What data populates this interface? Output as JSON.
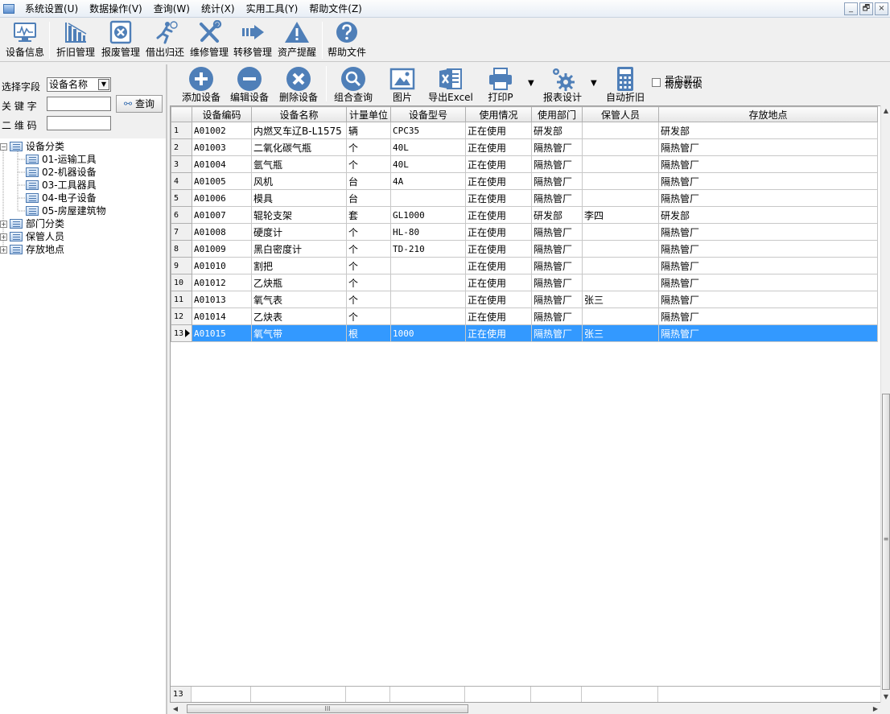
{
  "menu": {
    "items": [
      "系统设置(U)",
      "数据操作(V)",
      "查询(W)",
      "统计(X)",
      "实用工具(Y)",
      "帮助文件(Z)"
    ],
    "window_buttons": [
      "_",
      "🗗",
      "×"
    ]
  },
  "main_toolbar": {
    "buttons": [
      {
        "label": "设备信息",
        "icon": "monitor-icon"
      },
      {
        "label": "折旧管理",
        "icon": "depreciation-chart-icon"
      },
      {
        "label": "报废管理",
        "icon": "scrap-box-icon"
      },
      {
        "label": "借出归还",
        "icon": "lend-return-icon"
      },
      {
        "label": "维修管理",
        "icon": "repair-tools-icon"
      },
      {
        "label": "转移管理",
        "icon": "transfer-arrow-icon"
      },
      {
        "label": "资产提醒",
        "icon": "warning-icon"
      },
      {
        "label": "帮助文件",
        "icon": "help-icon"
      }
    ]
  },
  "filter": {
    "field_label": "选择字段",
    "field_value": "设备名称",
    "keyword_label": "关 键 字",
    "keyword_value": "",
    "qrcode_label": "二 维 码",
    "qrcode_value": "",
    "query_button": "查询"
  },
  "tree": {
    "root": "设备分类",
    "children": [
      "01-运输工具",
      "02-机器设备",
      "03-工具器具",
      "04-电子设备",
      "05-房屋建筑物"
    ],
    "others": [
      "部门分类",
      "保管人员",
      "存放地点"
    ]
  },
  "sub_toolbar": {
    "add": "添加设备",
    "edit": "编辑设备",
    "delete": "删除设备",
    "combo_query": "组合查询",
    "picture": "图片",
    "export_excel": "导出Excel",
    "print": "打印P",
    "report_design": "报表设计",
    "auto_depreciation": "自动折旧",
    "show_scrap_label": "是否显示报废数据",
    "show_scrap_checked": false
  },
  "grid": {
    "columns": [
      "设备编码",
      "设备名称",
      "计量单位",
      "设备型号",
      "使用情况",
      "使用部门",
      "保管人员",
      "存放地点"
    ],
    "rows": [
      {
        "n": "1",
        "code": "A01002",
        "name": "内燃叉车辽B-L1575",
        "unit": "辆",
        "model": "CPC35",
        "status": "正在使用",
        "dept": "研发部",
        "keeper": "",
        "location": "研发部"
      },
      {
        "n": "2",
        "code": "A01003",
        "name": "二氧化碳气瓶",
        "unit": "个",
        "model": "40L",
        "status": "正在使用",
        "dept": "隔热管厂",
        "keeper": "",
        "location": "隔热管厂"
      },
      {
        "n": "3",
        "code": "A01004",
        "name": "氩气瓶",
        "unit": "个",
        "model": "40L",
        "status": "正在使用",
        "dept": "隔热管厂",
        "keeper": "",
        "location": "隔热管厂"
      },
      {
        "n": "4",
        "code": "A01005",
        "name": "风机",
        "unit": "台",
        "model": "4A",
        "status": "正在使用",
        "dept": "隔热管厂",
        "keeper": "",
        "location": "隔热管厂"
      },
      {
        "n": "5",
        "code": "A01006",
        "name": "模具",
        "unit": "台",
        "model": "",
        "status": "正在使用",
        "dept": "隔热管厂",
        "keeper": "",
        "location": "隔热管厂"
      },
      {
        "n": "6",
        "code": "A01007",
        "name": "辊轮支架",
        "unit": "套",
        "model": "GL1000",
        "status": "正在使用",
        "dept": "研发部",
        "keeper": "李四",
        "location": "研发部"
      },
      {
        "n": "7",
        "code": "A01008",
        "name": "硬度计",
        "unit": "个",
        "model": "HL-80",
        "status": "正在使用",
        "dept": "隔热管厂",
        "keeper": "",
        "location": "隔热管厂"
      },
      {
        "n": "8",
        "code": "A01009",
        "name": "黑白密度计",
        "unit": "个",
        "model": "TD-210",
        "status": "正在使用",
        "dept": "隔热管厂",
        "keeper": "",
        "location": "隔热管厂"
      },
      {
        "n": "9",
        "code": "A01010",
        "name": "割把",
        "unit": "个",
        "model": "",
        "status": "正在使用",
        "dept": "隔热管厂",
        "keeper": "",
        "location": "隔热管厂"
      },
      {
        "n": "10",
        "code": "A01012",
        "name": "乙炔瓶",
        "unit": "个",
        "model": "",
        "status": "正在使用",
        "dept": "隔热管厂",
        "keeper": "",
        "location": "隔热管厂"
      },
      {
        "n": "11",
        "code": "A01013",
        "name": "氧气表",
        "unit": "个",
        "model": "",
        "status": "正在使用",
        "dept": "隔热管厂",
        "keeper": "张三",
        "location": "隔热管厂"
      },
      {
        "n": "12",
        "code": "A01014",
        "name": "乙炔表",
        "unit": "个",
        "model": "",
        "status": "正在使用",
        "dept": "隔热管厂",
        "keeper": "",
        "location": "隔热管厂"
      },
      {
        "n": "13",
        "code": "A01015",
        "name": "氧气带",
        "unit": "根",
        "model": "1000",
        "status": "正在使用",
        "dept": "隔热管厂",
        "keeper": "张三",
        "location": "隔热管厂"
      }
    ],
    "selected_row": "13",
    "record_count": "13"
  },
  "scroll": {
    "thumb_grip": "≡",
    "hthumb_grip": "III"
  },
  "colors": {
    "accent": "#3a6fb0",
    "selection": "#3399ff",
    "icon_blue": "#4f7fb8"
  }
}
